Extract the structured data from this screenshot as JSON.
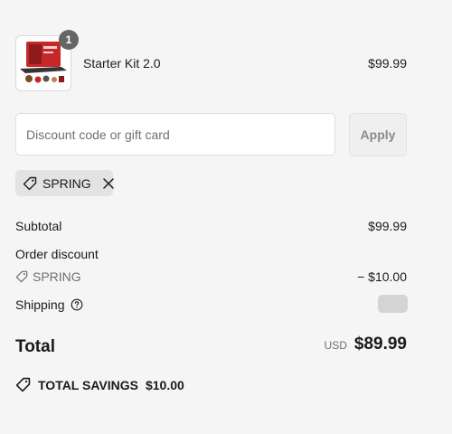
{
  "product": {
    "name": "Starter Kit 2.0",
    "price": "$99.99",
    "quantity": "1",
    "image_icon": "product-kit-image"
  },
  "discount": {
    "placeholder": "Discount code or gift card",
    "value": "",
    "apply_label": "Apply"
  },
  "applied_code": {
    "label": "SPRING",
    "icon": "tag-icon",
    "remove_icon": "close-icon"
  },
  "summary": {
    "subtotal_label": "Subtotal",
    "subtotal_value": "$99.99",
    "order_discount_label": "Order discount",
    "discount_code": "SPRING",
    "discount_value": "− $10.00",
    "shipping_label": "Shipping",
    "shipping_help_icon": "question-circle-icon"
  },
  "total": {
    "label": "Total",
    "currency": "USD",
    "amount": "$89.99"
  },
  "savings": {
    "label": "TOTAL SAVINGS",
    "amount": "$10.00"
  },
  "colors": {
    "background": "#f5f5f5",
    "text": "#1a1a1a",
    "muted": "#707070",
    "badge": "#666666",
    "chip": "#e3e3e3",
    "apply_button": "#efefef"
  }
}
